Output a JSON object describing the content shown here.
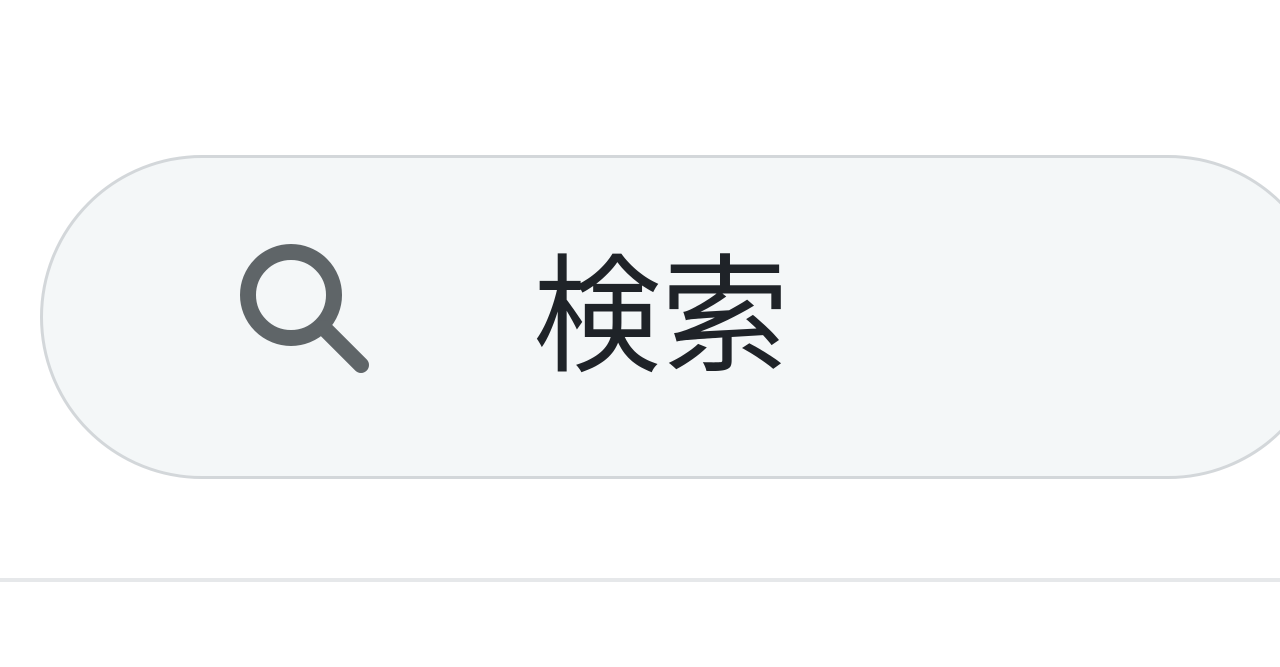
{
  "search": {
    "placeholder": "検索",
    "value": "",
    "icon": "search-icon"
  },
  "colors": {
    "field_background": "#f4f7f8",
    "field_border": "#d3d7da",
    "icon": "#5f6568",
    "text": "#1f2328",
    "divider": "#e6e8ea"
  }
}
